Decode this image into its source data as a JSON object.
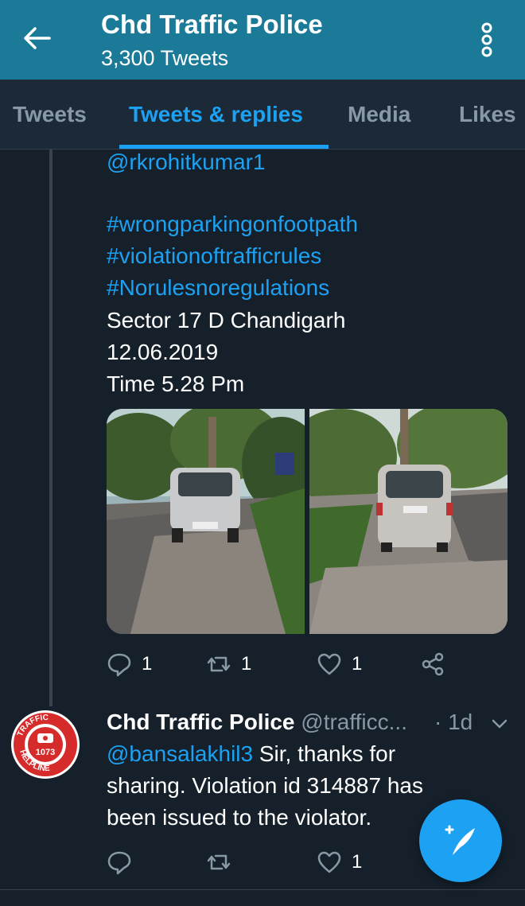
{
  "header": {
    "title": "Chd Traffic Police",
    "subtitle": "3,300 Tweets",
    "back_icon": "arrow-left-icon",
    "menu_icon": "overflow-menu-icon"
  },
  "tabs": [
    {
      "label": "Tweets",
      "active": false
    },
    {
      "label": "Tweets & replies",
      "active": true
    },
    {
      "label": "Media",
      "active": false
    },
    {
      "label": "Likes",
      "active": false
    }
  ],
  "tweet1": {
    "lines": [
      "@rkrohitkumar1",
      "#wrongparkingonfootpath",
      "#violationoftrafficrules",
      "#Norulesnoregulations",
      "Sector 17 D Chandigarh",
      "12.06.2019",
      "Time 5.28 Pm"
    ],
    "photos": [
      "car-parked-on-footpath-front",
      "car-parked-on-footpath-rear"
    ],
    "replies": "1",
    "retweets": "1",
    "likes": "1"
  },
  "tweet2": {
    "name": "Chd Traffic Police",
    "handle": "@trafficc...",
    "time": "· 1d",
    "mention": "@bansalakhil3",
    "text_line1": " Sir, thanks for",
    "text_line2": "sharing. Violation id 314887 has",
    "text_line3": "been issued to the violator.",
    "replies": "",
    "retweets": "",
    "likes": "1",
    "avatar": {
      "top_text": "TRAFFIC",
      "number": "1073",
      "bottom_text": "HELPLINE"
    }
  },
  "fab": {
    "icon": "compose-tweet-icon"
  },
  "colors": {
    "background": "#15202b",
    "header": "#1b7a97",
    "accent": "#1da1f2",
    "muted": "#8899a6"
  }
}
